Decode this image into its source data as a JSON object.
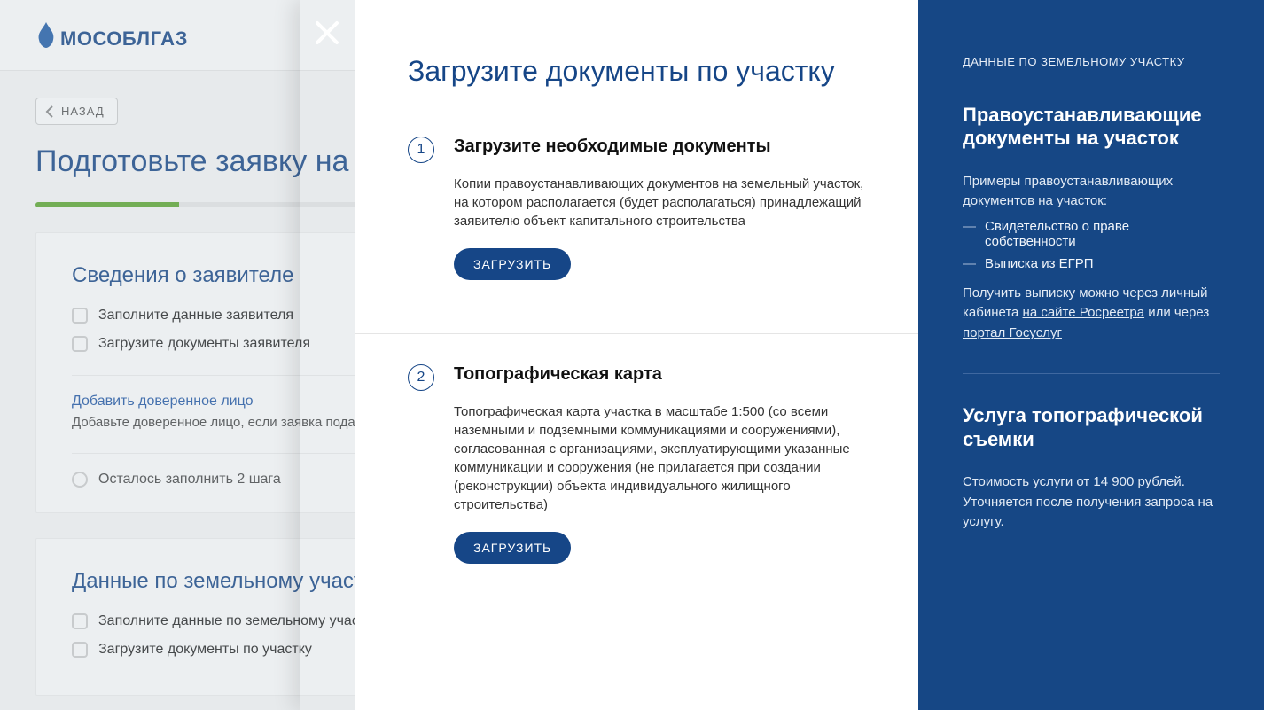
{
  "brand": "МОСОБЛГАЗ",
  "bg": {
    "back": "НАЗАД",
    "title": "Подготовьте заявку на подключение",
    "card1": {
      "title": "Сведения о заявителе",
      "item1": "Заполните данные заявителя",
      "item2": "Загрузите документы заявителя",
      "addLink": "Добавить доверенное лицо",
      "addNote": "Добавьте доверенное лицо, если заявка подается по доверенности",
      "status": "Осталось заполнить 2 шага"
    },
    "card2": {
      "title": "Данные по земельному участку",
      "item1": "Заполните данные по земельному участку",
      "item2": "Загрузите документы по участку"
    }
  },
  "panel": {
    "title": "Загрузите документы по участку",
    "step1": {
      "num": "1",
      "heading": "Загрузите необходимые документы",
      "text": "Копии правоустанавливающих документов на земельный участок, на котором располагается (будет располагаться) принадлежащий заявителю объект капитального строительства",
      "button": "ЗАГРУЗИТЬ"
    },
    "step2": {
      "num": "2",
      "heading": "Топографическая карта",
      "text": "Топографическая карта участка в масштабе 1:500 (со всеми наземными и подземными коммуникациями и сооружениями), согласованная с организациями, эксплуатирующими указанные коммуникации и сооружения (не прилагается при создании (реконструкции) объекта индивидуального жилищного строительства)",
      "button": "ЗАГРУЗИТЬ"
    }
  },
  "side": {
    "caption": "ДАННЫЕ ПО ЗЕМЕЛЬНОМУ УЧАСТКУ",
    "h1": "Правоустанавливающие документы на участок",
    "intro": "Примеры правоустанавливающих документов на участок:",
    "bullet1": "Свидетельство о праве собственности",
    "bullet2": "Выписка из ЕГРП",
    "line2a": "Получить выписку можно через личный кабинета ",
    "link1": "на сайте Росреетра",
    "line2b": " или через ",
    "link2": "портал Госуслуг",
    "h2": "Услуга топографической съемки",
    "service": "Стоимость услуги от 14 900 рублей. Уточняется после получения запроса на услугу."
  }
}
